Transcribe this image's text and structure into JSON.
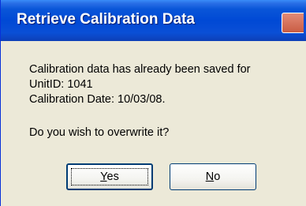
{
  "window": {
    "title": "Retrieve Calibration Data"
  },
  "message": {
    "line1": "Calibration data has already been saved for",
    "line2": "UnitID: 1041",
    "line3": "Calibration Date: 10/03/08.",
    "question": "Do you wish to overwrite it?"
  },
  "buttons": {
    "yes": {
      "label": "Yes",
      "mnemonic": "Y",
      "rest": "es"
    },
    "no": {
      "label": "No",
      "mnemonic": "N",
      "rest": "o"
    }
  },
  "colors": {
    "titlebar": "#0049d5",
    "dialog_background": "#ece9d8",
    "close_button": "#c95c43"
  },
  "icons": {
    "close": "close-icon"
  }
}
